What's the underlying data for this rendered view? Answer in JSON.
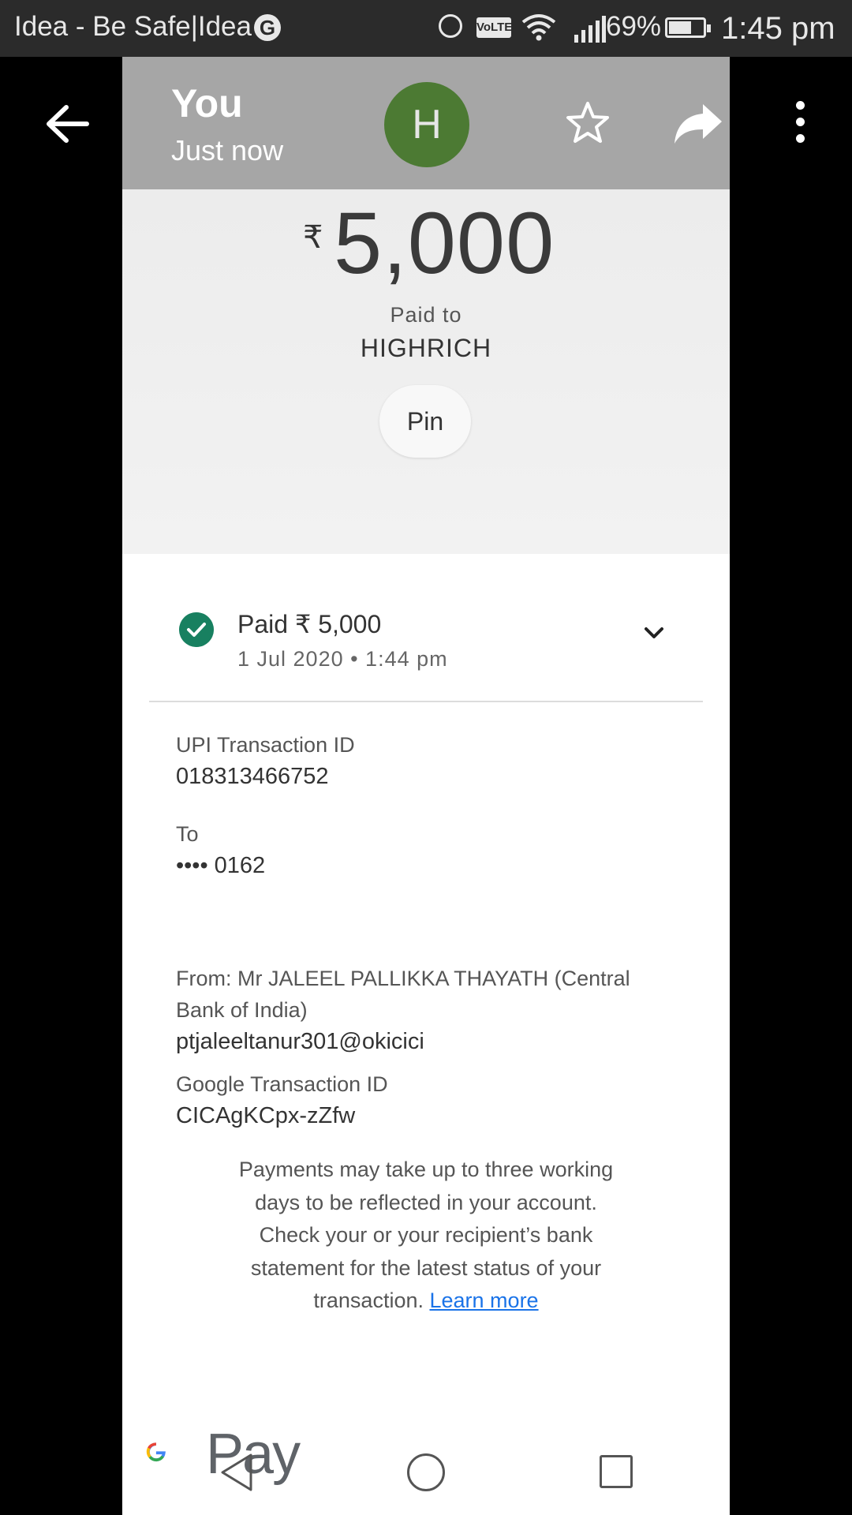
{
  "status_bar": {
    "carrier": "Idea - Be Safe|Idea",
    "volte": "VoLTE",
    "battery_percent": "69%",
    "time": "1:45 pm"
  },
  "header": {
    "name": "You",
    "subtitle": "Just now",
    "avatar_initial": "H",
    "avatar_color": "#4c7a33"
  },
  "payment": {
    "currency_symbol": "₹",
    "amount": "5,000",
    "paid_to_label": "Paid to",
    "merchant": "HIGHRICH",
    "pin_label": "Pin"
  },
  "status": {
    "text": "Paid ₹ 5,000",
    "date": "1 Jul 2020 • 1:44 pm",
    "icon": "check-circle-icon",
    "color": "#188060"
  },
  "details": {
    "upi_label": "UPI Transaction ID",
    "upi_value": "018313466752",
    "to_label": "To",
    "to_value": "•••• 0162",
    "from_label_line1": "From: Mr JALEEL PALLIKKA THAYATH (Central",
    "from_label_line2": "Bank of India)",
    "from_value": "ptjaleeltanur301@okicici",
    "google_label": "Google Transaction ID",
    "google_value": "CICAgKCpx-zZfw"
  },
  "note": {
    "line1": "Payments may take up to three working",
    "line2": "days to be reflected in your account.",
    "line3": "Check your or your recipient’s bank",
    "line4": "statement for the latest status of your",
    "line5": "transaction.",
    "link": "Learn more",
    "link_color": "#1a73e8"
  },
  "footer": {
    "pay_text": "Pay"
  },
  "icons": [
    "back-arrow-icon",
    "star-icon",
    "share-icon",
    "more-vert-icon",
    "chevron-down-icon",
    "google-g-icon",
    "nav-back-icon",
    "nav-home-icon",
    "nav-recents-icon"
  ]
}
